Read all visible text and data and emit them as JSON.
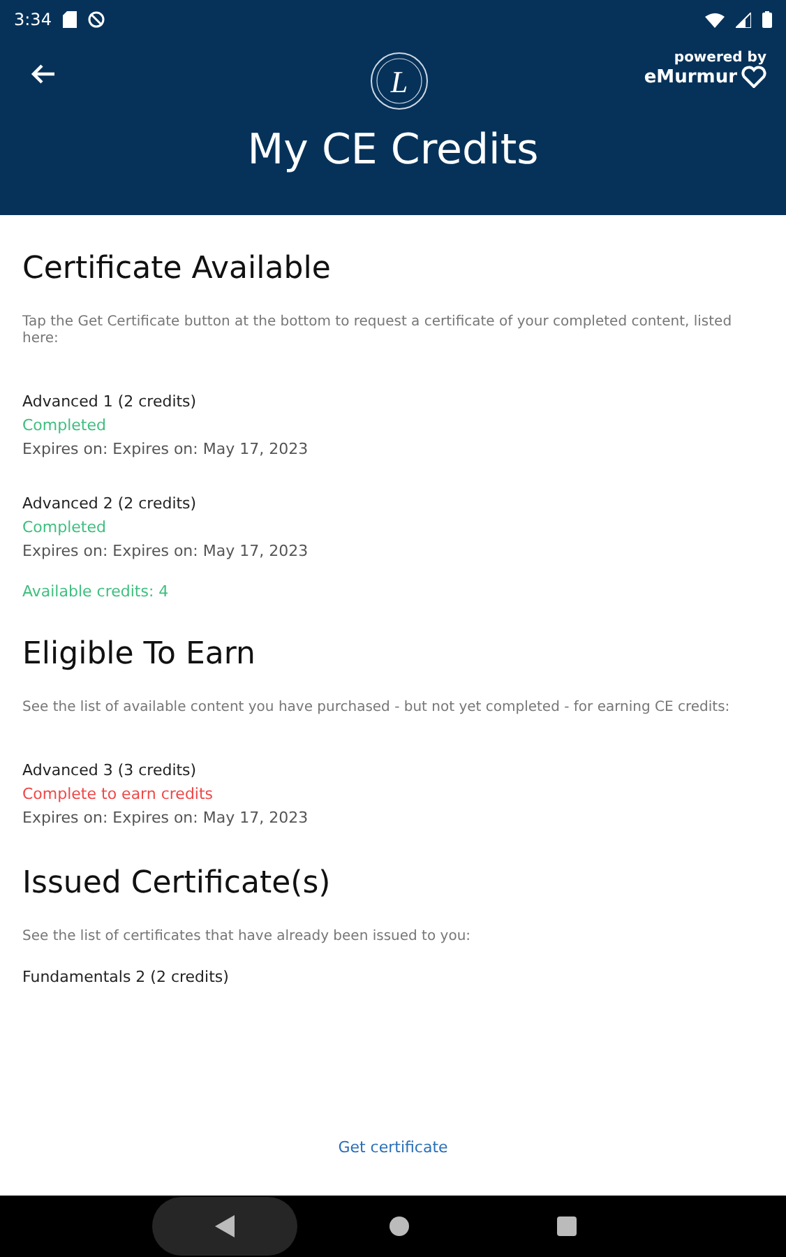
{
  "status_bar": {
    "time": "3:34"
  },
  "header": {
    "title": "My CE Credits",
    "powered_by": "powered by",
    "brand": "eMurmur",
    "logo_letter": "L"
  },
  "sections": [
    {
      "heading": "Certificate Available",
      "description": "Tap the Get Certificate button at the bottom to request a certificate of your completed content, listed here:",
      "items": [
        {
          "name": "Advanced 1 (2 credits)",
          "status": {
            "text": "Completed",
            "kind": "done"
          },
          "expires": "Expires on: Expires on: May 17, 2023"
        },
        {
          "name": "Advanced 2 (2 credits)",
          "status": {
            "text": "Completed",
            "kind": "done"
          },
          "expires": "Expires on: Expires on: May 17, 2023"
        }
      ],
      "summary": "Available credits: 4"
    },
    {
      "heading": "Eligible To Earn",
      "description": "See the list of available content you have purchased - but not yet completed - for earning CE credits:",
      "items": [
        {
          "name": "Advanced 3 (3 credits)",
          "status": {
            "text": "Complete to earn credits",
            "kind": "todo"
          },
          "expires": "Expires on: Expires on: May 17, 2023"
        }
      ]
    },
    {
      "heading": "Issued Certificate(s)",
      "description": "See the list of certificates that have already been issued to you:",
      "items": [
        {
          "name": "Fundamentals 2 (2 credits)"
        }
      ]
    }
  ],
  "action": {
    "label": "Get certificate"
  }
}
